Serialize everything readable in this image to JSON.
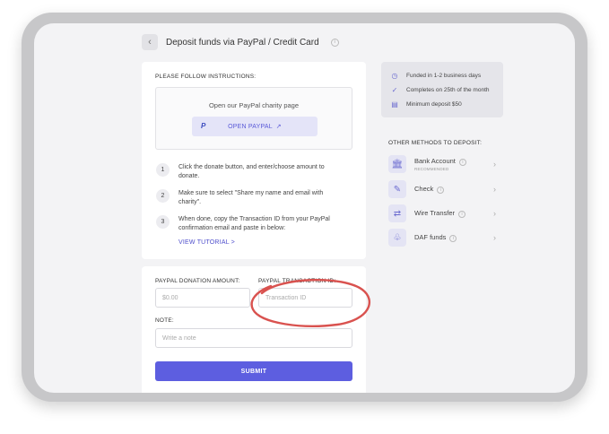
{
  "header": {
    "back_icon": "chevron-left",
    "title": "Deposit funds via PayPal / Credit Card",
    "info_icon": "i"
  },
  "instructions": {
    "heading": "PLEASE FOLLOW INSTRUCTIONS:",
    "paypal_box_text": "Open our PayPal charity page",
    "open_paypal_label": "OPEN PAYPAL",
    "open_paypal_arrow": "↗",
    "steps": [
      {
        "num": "1",
        "text": "Click the donate button, and enter/choose amount to donate."
      },
      {
        "num": "2",
        "text": "Make sure to select  \"Share my name and email with charity\"."
      },
      {
        "num": "3",
        "text": "When done, copy the Transaction ID from your PayPal confirmation email and paste in below:"
      }
    ],
    "tutorial_link": "VIEW TUTORIAL  >"
  },
  "form": {
    "amount_label": "PAYPAL DONATION AMOUNT:",
    "amount_placeholder": "$0.00",
    "transaction_label": "PAYPAL TRANSACTION ID:",
    "transaction_placeholder": "Transaction ID",
    "note_label": "NOTE:",
    "note_placeholder": "Write a note",
    "submit_label": "SUBMIT"
  },
  "info_card": {
    "items": [
      {
        "icon": "clock-icon",
        "glyph": "◷",
        "text": "Funded in 1-2 business days"
      },
      {
        "icon": "check-icon",
        "glyph": "✓",
        "text": "Completes on 25th of the month"
      },
      {
        "icon": "receipt-icon",
        "glyph": "▤",
        "text": "Minimum deposit $50"
      }
    ]
  },
  "other_methods": {
    "heading": "OTHER METHODS TO DEPOSIT:",
    "items": [
      {
        "label": "Bank Account",
        "sub": "RECOMMENDED",
        "icon": "bank-icon",
        "glyph": "🏛"
      },
      {
        "label": "Check",
        "sub": "",
        "icon": "check-doc-icon",
        "glyph": "✎"
      },
      {
        "label": "Wire Transfer",
        "sub": "",
        "icon": "wire-transfer-icon",
        "glyph": "⇄"
      },
      {
        "label": "DAF funds",
        "sub": "",
        "icon": "daf-icon",
        "glyph": "♧"
      }
    ],
    "chevron": "›"
  },
  "colors": {
    "accent": "#5d5ee0",
    "annotation_ring": "#d9524f"
  }
}
